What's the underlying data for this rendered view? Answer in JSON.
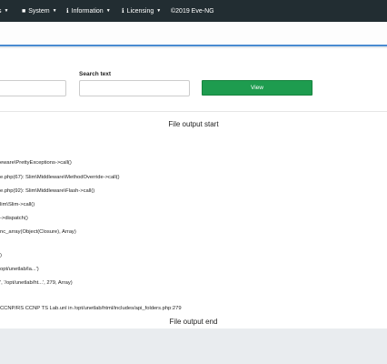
{
  "nav": {
    "system_label": "System",
    "information_label": "Information",
    "licensing_label": "Licensing",
    "copyright": "©2019 Eve-NG"
  },
  "form": {
    "search_label": "Search text",
    "view_button": "View"
  },
  "output": {
    "start_label": "File output start",
    "end_label": "File output end",
    "lines": [
      "eware\\PrettyExceptions->call()",
      "e.php(67): Slim\\Middleware\\MethodOverride->call()",
      "e.php(92): Slim\\Middleware\\Flash->call()",
      "lim\\Slim->call()",
      "->dispatch()",
      "nc_array(Object(Closure), Array)",
      ")",
      "opt/unetlab/la...')",
      "', '/opt/unetlab/ht...', 279, Array)",
      "CCNP/RS CCNP TS Lab.unl in /opt/unetlab/html/includes/api_folders.php:279"
    ]
  }
}
